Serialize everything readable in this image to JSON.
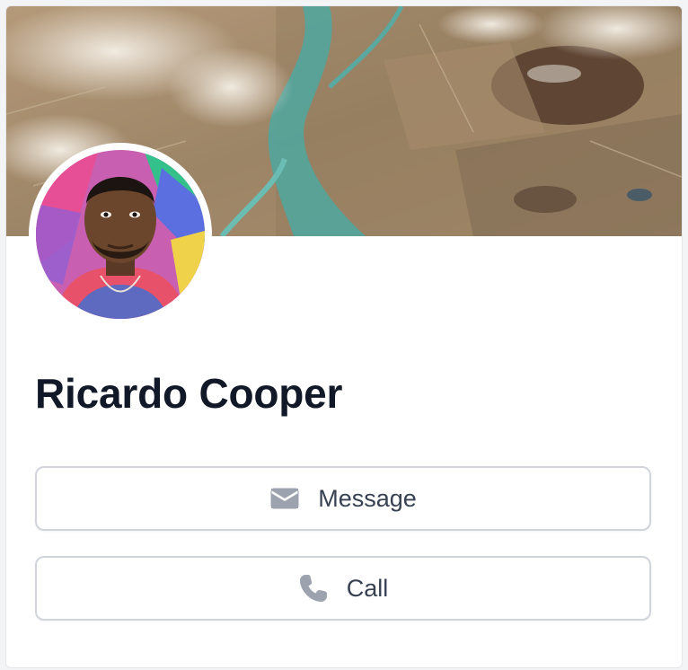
{
  "profile": {
    "name": "Ricardo Cooper"
  },
  "actions": {
    "message_label": "Message",
    "call_label": "Call"
  },
  "icons": {
    "message": "envelope-icon",
    "call": "phone-icon"
  },
  "colors": {
    "name_text": "#111827",
    "button_text": "#374151",
    "icon": "#9ca3af",
    "border": "#d1d5db"
  }
}
